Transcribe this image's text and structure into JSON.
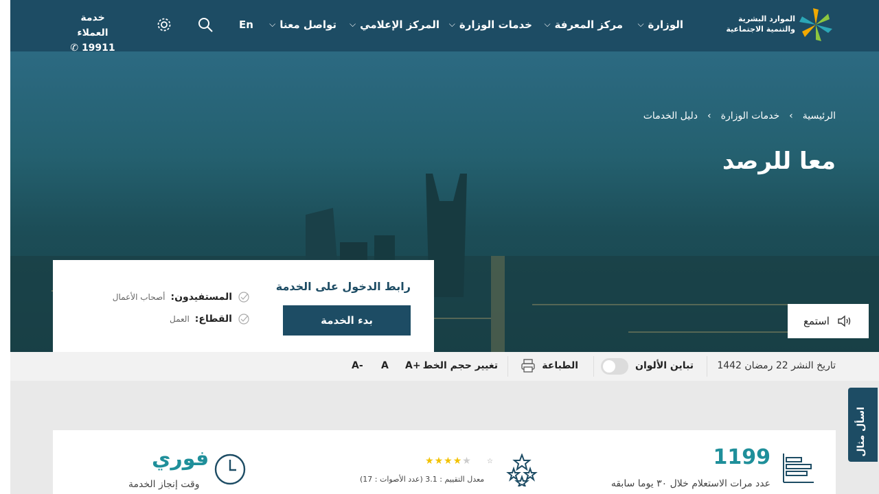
{
  "header": {
    "logo_text": "الموارد البشرية والتنمية الاجتماعية",
    "nav": [
      {
        "label": "الوزارة"
      },
      {
        "label": "مركز المعرفة"
      },
      {
        "label": "خدمات الوزارة"
      },
      {
        "label": "المركز الإعلامي"
      },
      {
        "label": "تواصل معنا"
      }
    ],
    "lang": "En",
    "customer_service": {
      "label": "خدمة العملاء",
      "number": "19911"
    }
  },
  "hero": {
    "breadcrumb": [
      "الرئيسية",
      "خدمات الوزارة",
      "دليل الخدمات"
    ],
    "title": "معا للرصد",
    "listen": "استمع"
  },
  "service_box": {
    "title": "رابط الدخول على الخدمة",
    "button": "بدء الخدمة",
    "beneficiaries_label": "المستفيدون:",
    "beneficiaries_value": "أصحاب الأعمال",
    "sector_label": "القطاع:",
    "sector_value": "العمل"
  },
  "toolbar": {
    "publish_date": "تاريخ النشر 22 رمضان 1442",
    "contrast": "تباين الألوان",
    "print": "الطباعة",
    "font_size": "تغيير حجم الخط",
    "font_plus": "A+",
    "font_normal": "A",
    "font_minus": "A-"
  },
  "stats": {
    "inquiries_count": "1199",
    "inquiries_label": "عدد مرات الاستعلام خلال ٣٠ يوما سابقه",
    "rating_label": "معدل التقييم : 3.1 (عدد الأصوات : 17)",
    "rating_value": 3.1,
    "time_value": "فوري",
    "time_label": "وقت إنجاز الخدمة"
  },
  "side_tab": "اسأل مثال",
  "colors": {
    "primary": "#1d4c64",
    "accent": "#1f8f9a",
    "star": "#f2c200"
  }
}
